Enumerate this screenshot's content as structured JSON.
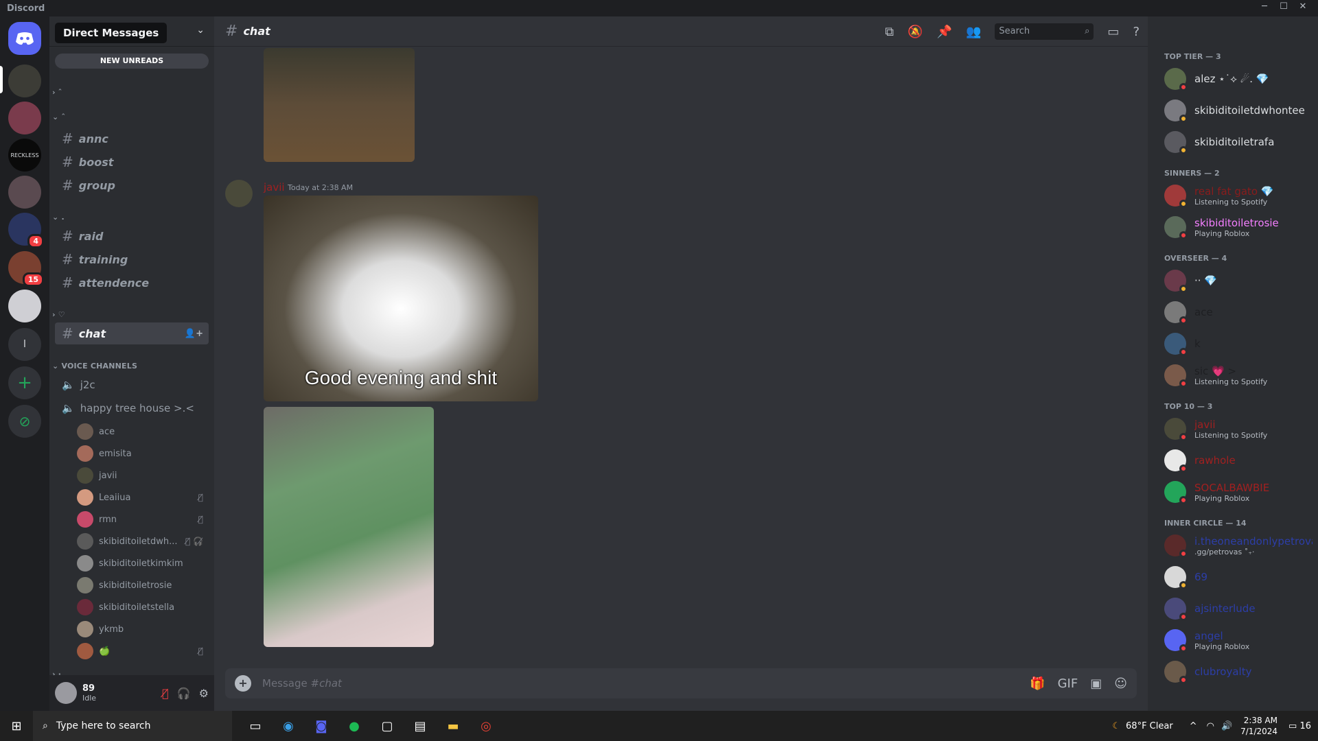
{
  "app": {
    "title": "Discord"
  },
  "window_controls": {
    "minimize": "─",
    "maximize": "☐",
    "close": "✕"
  },
  "servers": {
    "tooltip": "Direct Messages",
    "badges": [
      "4",
      "15"
    ],
    "add_label": "+",
    "explore_label": "⊘",
    "text_server_label": "l"
  },
  "channel_list": {
    "new_unreads": "NEW UNREADS",
    "categories": {
      "cat1": "› ˆ",
      "cat2": "⌄ ˆ",
      "cat3": "⌄ .",
      "cat4": "› ♡",
      "voice": "⌄ VOICE CHANNELS",
      "bottom": "› ·"
    },
    "text_channels": [
      "annc",
      "boost",
      "group",
      "raid",
      "training",
      "attendence",
      "chat"
    ],
    "voice_channels": [
      "j2c",
      "happy tree house >.<"
    ],
    "voice_users": [
      "ace",
      "emisita",
      "javii",
      "Leaiiua",
      "rmn",
      "skibiditoiletdwh...",
      "skibiditoiletkimkim",
      "skibiditoiletrosie",
      "skibiditoiletstella",
      "ykmb",
      "🍏"
    ]
  },
  "user_panel": {
    "name": "89",
    "status": "Idle"
  },
  "header": {
    "channel": "chat",
    "search_placeholder": "Search"
  },
  "message": {
    "author": "javii",
    "timestamp": "Today at 2:38 AM",
    "caption": "Good evening and shit"
  },
  "composer": {
    "placeholder_prefix": "Message ",
    "placeholder_channel": "#chat"
  },
  "members": {
    "groups": [
      {
        "title": "TOP TIER — 3",
        "members": [
          {
            "name": "alez ⋆˙⟡ ☄. 💎",
            "sub": "",
            "color": "#dbdee1"
          },
          {
            "name": "skibiditoiletdwhontee",
            "sub": "",
            "color": "#dbdee1"
          },
          {
            "name": "skibiditoiletrafa",
            "sub": "",
            "color": "#dbdee1"
          }
        ]
      },
      {
        "title": "SINNERS — 2",
        "members": [
          {
            "name": "real fat gato 💎",
            "sub": "Listening to Spotify",
            "color": "#8a1c1c"
          },
          {
            "name": "skibiditoiletrosie",
            "sub": "Playing Roblox",
            "color": "#f47fff"
          }
        ]
      },
      {
        "title": "OVERSEER — 4",
        "members": [
          {
            "name": "·· 💎",
            "sub": "",
            "color": "#dbdee1"
          },
          {
            "name": "ace",
            "sub": "",
            "color": "#1e1f22"
          },
          {
            "name": "k",
            "sub": "",
            "color": "#1e1f22"
          },
          {
            "name": "sic 💗 >",
            "sub": "Listening to Spotify",
            "color": "#1e1f22"
          }
        ]
      },
      {
        "title": "TOP 10 — 3",
        "members": [
          {
            "name": "javii",
            "sub": "Listening to Spotify",
            "color": "#a12020"
          },
          {
            "name": "rawhole",
            "sub": "",
            "color": "#a12020"
          },
          {
            "name": "SOCALBAWBIE",
            "sub": "Playing Roblox",
            "color": "#a12020"
          }
        ]
      },
      {
        "title": "INNER CIRCLE — 14",
        "members": [
          {
            "name": "i.theoneandonlypetrova",
            "sub": ".gg/petrovas ˚₊‧",
            "color": "#2c3ea8"
          },
          {
            "name": "69",
            "sub": "",
            "color": "#2c3ea8"
          },
          {
            "name": "ajsinterlude",
            "sub": "",
            "color": "#2c3ea8"
          },
          {
            "name": "angel",
            "sub": "Playing Roblox",
            "color": "#2c3ea8"
          },
          {
            "name": "clubroyalty",
            "sub": "",
            "color": "#2c3ea8"
          }
        ]
      }
    ]
  },
  "taskbar": {
    "search_placeholder": "Type here to search",
    "weather": "68°F  Clear",
    "time": "2:38 AM",
    "date": "7/1/2024",
    "notifications": "16"
  },
  "colors": {
    "accent": "#5865f2",
    "red": "#f23f43",
    "green": "#23a55a",
    "idle": "#f0b232"
  }
}
